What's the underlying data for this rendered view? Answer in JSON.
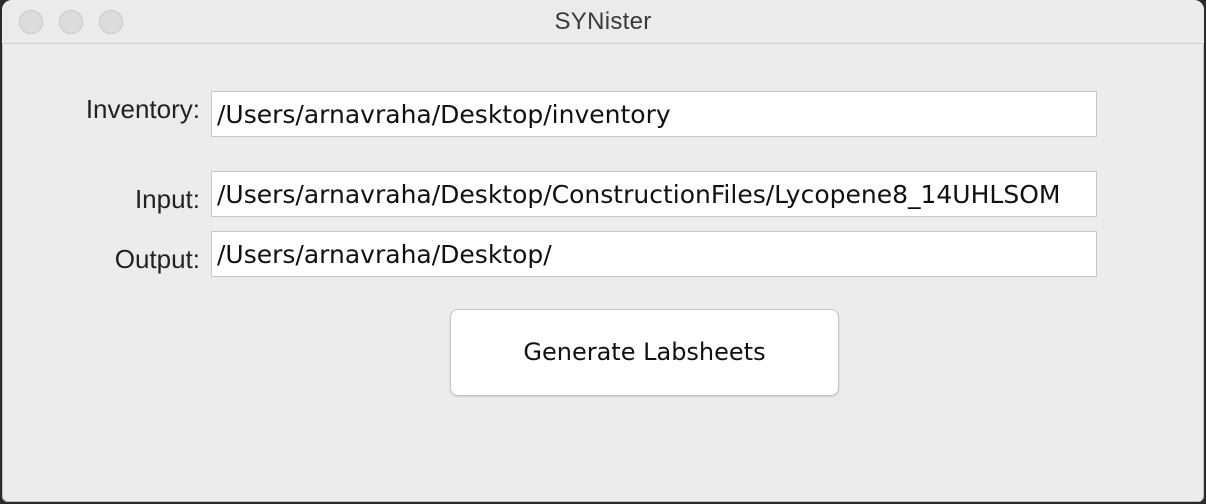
{
  "window": {
    "title": "SYNister"
  },
  "form": {
    "inventory": {
      "label": "Inventory:",
      "value": "/Users/arnavraha/Desktop/inventory"
    },
    "input": {
      "label": "Input:",
      "value": "/Users/arnavraha/Desktop/ConstructionFiles/Lycopene8_14UHLSOM"
    },
    "output": {
      "label": "Output:",
      "value": "/Users/arnavraha/Desktop/"
    }
  },
  "actions": {
    "generate_label": "Generate Labsheets"
  }
}
